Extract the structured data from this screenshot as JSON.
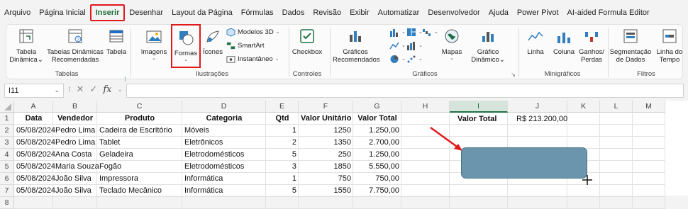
{
  "menu": [
    "Arquivo",
    "Página Inicial",
    "Inserir",
    "Desenhar",
    "Layout da Página",
    "Fórmulas",
    "Dados",
    "Revisão",
    "Exibir",
    "Automatizar",
    "Desenvolvedor",
    "Ajuda",
    "Power Pivot",
    "AI-aided Formula Editor"
  ],
  "ribbon": {
    "tabelas": {
      "label": "Tabelas",
      "tabela_dinamica": [
        "Tabela",
        "Dinâmica"
      ],
      "tabelas_recomendadas": [
        "Tabelas Dinâmicas",
        "Recomendadas"
      ],
      "tabela": "Tabela"
    },
    "ilustracoes": {
      "label": "Ilustrações",
      "imagens": "Imagens",
      "formas": "Formas",
      "icones": "Ícones",
      "modelos3d": "Modelos 3D",
      "smartart": "SmartArt",
      "instantaneo": "Instantâneo"
    },
    "controles": {
      "label": "Controles",
      "checkbox": "Checkbox"
    },
    "graficos": {
      "label": "Gráficos",
      "recomendados": [
        "Gráficos",
        "Recomendados"
      ],
      "mapas": "Mapas",
      "grafico_dinamico": [
        "Gráfico",
        "Dinâmico"
      ]
    },
    "minigraficos": {
      "label": "Minigráficos",
      "linha": "Linha",
      "coluna": "Coluna",
      "ganhos": [
        "Ganhos/",
        "Perdas"
      ]
    },
    "filtros": {
      "label": "Filtros",
      "segmentacao": [
        "Segmentação",
        "de Dados"
      ],
      "linha_tempo": [
        "Linha do",
        "Tempo"
      ]
    }
  },
  "formula_bar": {
    "name_box": "I11",
    "fx": "fx",
    "value": ""
  },
  "columns": [
    "A",
    "B",
    "C",
    "D",
    "E",
    "F",
    "G",
    "H",
    "I",
    "J",
    "K",
    "L",
    "M"
  ],
  "rows": [
    "1",
    "2",
    "3",
    "4",
    "5",
    "6",
    "7",
    "8"
  ],
  "table": {
    "headers": [
      "Data",
      "Vendedor",
      "Produto",
      "Categoria",
      "Qtd",
      "Valor Unitário",
      "Valor Total"
    ],
    "rows": [
      [
        "05/08/2024",
        "Pedro Lima",
        "Cadeira de Escritório",
        "Móveis",
        "1",
        "1250",
        "1.250,00"
      ],
      [
        "05/08/2024",
        "Pedro Lima",
        "Tablet",
        "Eletrônicos",
        "2",
        "1350",
        "2.700,00"
      ],
      [
        "05/08/2024",
        "Ana Costa",
        "Geladeira",
        "Eletrodomésticos",
        "5",
        "250",
        "1.250,00"
      ],
      [
        "05/08/2024",
        "Maria Souza",
        "Fogão",
        "Eletrodomésticos",
        "3",
        "1850",
        "5.550,00"
      ],
      [
        "05/08/2024",
        "João Silva",
        "Impressora",
        "Informática",
        "1",
        "750",
        "750,00"
      ],
      [
        "05/08/2024",
        "João Silva",
        "Teclado Mecânico",
        "Informática",
        "5",
        "1550",
        "7.750,00"
      ]
    ]
  },
  "summary": {
    "label": "Valor Total",
    "value": "R$  213.200,00"
  },
  "colors": {
    "accent": "#1e7145",
    "highlight": "#e0191c",
    "shape_fill": "#6a95ad"
  }
}
